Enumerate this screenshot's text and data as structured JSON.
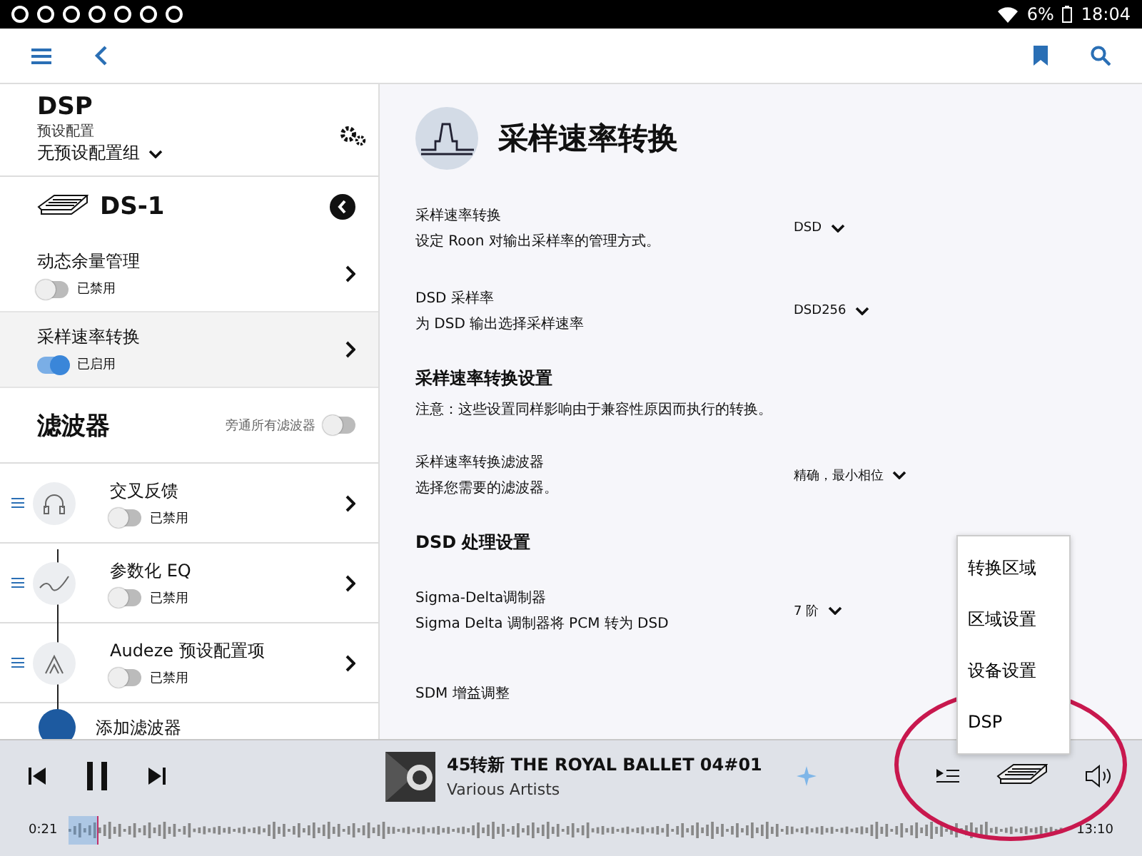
{
  "status_bar": {
    "battery": "6%",
    "time": "18:04"
  },
  "sidebar": {
    "title": "DSP",
    "preset_label": "预设配置",
    "preset_value": "无预设配置组",
    "device": "DS-1",
    "items": [
      {
        "title": "动态余量管理",
        "on": false,
        "status": "已禁用",
        "selected": false
      },
      {
        "title": "采样速率转换",
        "on": true,
        "status": "已启用",
        "selected": true
      }
    ],
    "filters_title": "滤波器",
    "bypass_label": "旁通所有滤波器",
    "bypass_on": false,
    "filters": [
      {
        "kind": "headphone",
        "title": "交叉反馈",
        "on": false,
        "status": "已禁用"
      },
      {
        "kind": "eq",
        "title": "参数化 EQ",
        "on": false,
        "status": "已禁用"
      },
      {
        "kind": "preset",
        "title": "Audeze 预设配置项",
        "on": false,
        "status": "已禁用"
      }
    ],
    "add_filter": "添加滤波器"
  },
  "content": {
    "title": "采样速率转换",
    "settings": [
      {
        "kind": "setting",
        "label": "采样速率转换",
        "description": "设定 Roon 对输出采样率的管理方式。",
        "value": "DSD"
      },
      {
        "kind": "setting",
        "label": "DSD 采样率",
        "description": "为 DSD 输出选择采样速率",
        "value": "DSD256"
      },
      {
        "kind": "section",
        "heading": "采样速率转换设置",
        "note": "注意：这些设置同样影响由于兼容性原因而执行的转换。"
      },
      {
        "kind": "setting",
        "label": "采样速率转换滤波器",
        "description": "选择您需要的滤波器。",
        "value": "精确，最小相位"
      },
      {
        "kind": "section",
        "heading": "DSD 处理设置"
      },
      {
        "kind": "setting",
        "label": "Sigma-Delta调制器",
        "description": "Sigma Delta 调制器将 PCM 转为 DSD",
        "value": "7 阶"
      },
      {
        "kind": "setting",
        "label": "SDM 增益调整"
      }
    ]
  },
  "menu": {
    "items": [
      {
        "label": "转换区域"
      },
      {
        "label": "区域设置"
      },
      {
        "label": "设备设置"
      },
      {
        "label": "DSP"
      }
    ]
  },
  "player": {
    "playing": true,
    "title": "45转新 THE ROYAL BALLET 04#01",
    "artist": "Various Artists",
    "elapsed": "0:21",
    "duration": "13:10",
    "level": 0.03
  }
}
